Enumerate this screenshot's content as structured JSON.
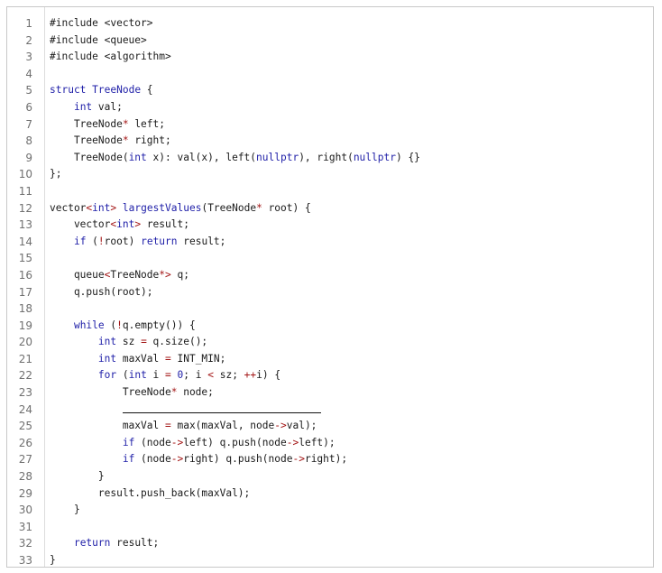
{
  "editor": {
    "lines": [
      {
        "n": "1",
        "s": [
          [
            "pp",
            "#include <vector>"
          ]
        ]
      },
      {
        "n": "2",
        "s": [
          [
            "pp",
            "#include <queue>"
          ]
        ]
      },
      {
        "n": "3",
        "s": [
          [
            "pp",
            "#include <algorithm>"
          ]
        ]
      },
      {
        "n": "4",
        "s": []
      },
      {
        "n": "5",
        "s": [
          [
            "kw",
            "struct"
          ],
          [
            "t",
            " "
          ],
          [
            "ty",
            "TreeNode"
          ],
          [
            "t",
            " {"
          ]
        ]
      },
      {
        "n": "6",
        "s": [
          [
            "t",
            "    "
          ],
          [
            "kw",
            "int"
          ],
          [
            "t",
            " val;"
          ]
        ]
      },
      {
        "n": "7",
        "s": [
          [
            "t",
            "    TreeNode"
          ],
          [
            "op",
            "*"
          ],
          [
            "t",
            " left;"
          ]
        ]
      },
      {
        "n": "8",
        "s": [
          [
            "t",
            "    TreeNode"
          ],
          [
            "op",
            "*"
          ],
          [
            "t",
            " right;"
          ]
        ]
      },
      {
        "n": "9",
        "s": [
          [
            "t",
            "    TreeNode("
          ],
          [
            "kw",
            "int"
          ],
          [
            "t",
            " x): val(x), left("
          ],
          [
            "kw",
            "nullptr"
          ],
          [
            "t",
            "), right("
          ],
          [
            "kw",
            "nullptr"
          ],
          [
            "t",
            ") {}"
          ]
        ]
      },
      {
        "n": "10",
        "s": [
          [
            "t",
            "};"
          ]
        ]
      },
      {
        "n": "11",
        "s": []
      },
      {
        "n": "12",
        "s": [
          [
            "t",
            "vector"
          ],
          [
            "op",
            "<"
          ],
          [
            "kw",
            "int"
          ],
          [
            "op",
            ">"
          ],
          [
            "t",
            " "
          ],
          [
            "fn",
            "largestValues"
          ],
          [
            "t",
            "(TreeNode"
          ],
          [
            "op",
            "*"
          ],
          [
            "t",
            " root) {"
          ]
        ]
      },
      {
        "n": "13",
        "s": [
          [
            "t",
            "    vector"
          ],
          [
            "op",
            "<"
          ],
          [
            "kw",
            "int"
          ],
          [
            "op",
            ">"
          ],
          [
            "t",
            " result;"
          ]
        ]
      },
      {
        "n": "14",
        "s": [
          [
            "t",
            "    "
          ],
          [
            "kw",
            "if"
          ],
          [
            "t",
            " ("
          ],
          [
            "op",
            "!"
          ],
          [
            "t",
            "root) "
          ],
          [
            "kw",
            "return"
          ],
          [
            "t",
            " result;"
          ]
        ]
      },
      {
        "n": "15",
        "s": []
      },
      {
        "n": "16",
        "s": [
          [
            "t",
            "    queue"
          ],
          [
            "op",
            "<"
          ],
          [
            "t",
            "TreeNode"
          ],
          [
            "op",
            "*>"
          ],
          [
            "t",
            " q;"
          ]
        ]
      },
      {
        "n": "17",
        "s": [
          [
            "t",
            "    q.push(root);"
          ]
        ]
      },
      {
        "n": "18",
        "s": []
      },
      {
        "n": "19",
        "s": [
          [
            "t",
            "    "
          ],
          [
            "kw",
            "while"
          ],
          [
            "t",
            " ("
          ],
          [
            "op",
            "!"
          ],
          [
            "t",
            "q.empty()) {"
          ]
        ]
      },
      {
        "n": "20",
        "s": [
          [
            "t",
            "        "
          ],
          [
            "kw",
            "int"
          ],
          [
            "t",
            " sz "
          ],
          [
            "op",
            "="
          ],
          [
            "t",
            " q.size();"
          ]
        ]
      },
      {
        "n": "21",
        "s": [
          [
            "t",
            "        "
          ],
          [
            "kw",
            "int"
          ],
          [
            "t",
            " maxVal "
          ],
          [
            "op",
            "="
          ],
          [
            "t",
            " INT_MIN;"
          ]
        ]
      },
      {
        "n": "22",
        "s": [
          [
            "t",
            "        "
          ],
          [
            "kw",
            "for"
          ],
          [
            "t",
            " ("
          ],
          [
            "kw",
            "int"
          ],
          [
            "t",
            " i "
          ],
          [
            "op",
            "="
          ],
          [
            "t",
            " "
          ],
          [
            "kw",
            "0"
          ],
          [
            "t",
            "; i "
          ],
          [
            "op",
            "<"
          ],
          [
            "t",
            " sz; "
          ],
          [
            "op",
            "++"
          ],
          [
            "t",
            "i) {"
          ]
        ]
      },
      {
        "n": "23",
        "s": [
          [
            "t",
            "            TreeNode"
          ],
          [
            "op",
            "*"
          ],
          [
            "t",
            " node;"
          ]
        ]
      },
      {
        "n": "24",
        "s": [
          [
            "t",
            "            "
          ],
          [
            "blank",
            ""
          ]
        ]
      },
      {
        "n": "25",
        "s": [
          [
            "t",
            "            maxVal "
          ],
          [
            "op",
            "="
          ],
          [
            "t",
            " max(maxVal, node"
          ],
          [
            "op",
            "->"
          ],
          [
            "t",
            "val);"
          ]
        ]
      },
      {
        "n": "26",
        "s": [
          [
            "t",
            "            "
          ],
          [
            "kw",
            "if"
          ],
          [
            "t",
            " (node"
          ],
          [
            "op",
            "->"
          ],
          [
            "t",
            "left) q.push(node"
          ],
          [
            "op",
            "->"
          ],
          [
            "t",
            "left);"
          ]
        ]
      },
      {
        "n": "27",
        "s": [
          [
            "t",
            "            "
          ],
          [
            "kw",
            "if"
          ],
          [
            "t",
            " (node"
          ],
          [
            "op",
            "->"
          ],
          [
            "t",
            "right) q.push(node"
          ],
          [
            "op",
            "->"
          ],
          [
            "t",
            "right);"
          ]
        ]
      },
      {
        "n": "28",
        "s": [
          [
            "t",
            "        }"
          ]
        ]
      },
      {
        "n": "29",
        "s": [
          [
            "t",
            "        result.push_back(maxVal);"
          ]
        ]
      },
      {
        "n": "30",
        "s": [
          [
            "t",
            "    }"
          ]
        ]
      },
      {
        "n": "31",
        "s": []
      },
      {
        "n": "32",
        "s": [
          [
            "t",
            "    "
          ],
          [
            "kw",
            "return"
          ],
          [
            "t",
            " result;"
          ]
        ]
      },
      {
        "n": "33",
        "s": [
          [
            "t",
            "}"
          ]
        ]
      }
    ]
  }
}
